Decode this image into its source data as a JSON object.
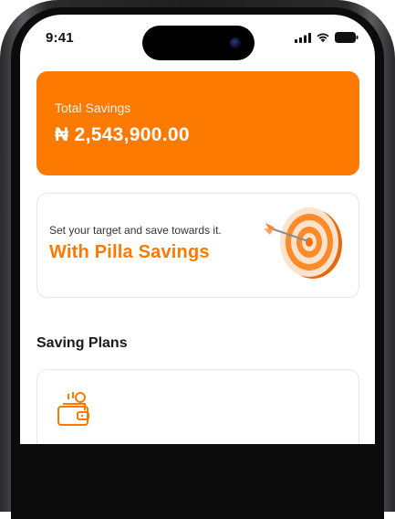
{
  "status_bar": {
    "time": "9:41"
  },
  "savings_card": {
    "label": "Total Savings",
    "amount": "₦ 2,543,900.00"
  },
  "promo_card": {
    "text": "Set your target and save towards it.",
    "title": "With Pilla Savings",
    "illustration": "dartboard-target-icon"
  },
  "section": {
    "title": "Saving Plans"
  },
  "plan_card": {
    "icon": "wallet-coins-icon"
  },
  "colors": {
    "accent": "#fd7a00",
    "card_border": "#e6e6e6"
  }
}
